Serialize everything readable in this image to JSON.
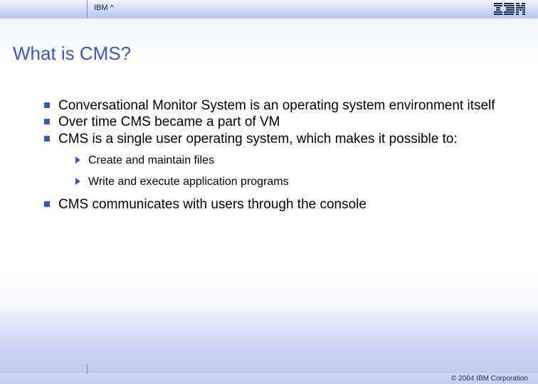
{
  "header": {
    "brand": "IBM ^"
  },
  "title": "What is CMS?",
  "bullets": {
    "b0": "Conversational Monitor System is an operating system environment itself",
    "b1": "Over time CMS became a part of VM",
    "b2": "CMS is a single user operating system, which makes it possible to:",
    "sub0": "Create and maintain files",
    "sub1": "Write and execute application programs",
    "b3": "CMS communicates with users through the console"
  },
  "footer": {
    "copyright": "© 2004 IBM Corporation"
  }
}
